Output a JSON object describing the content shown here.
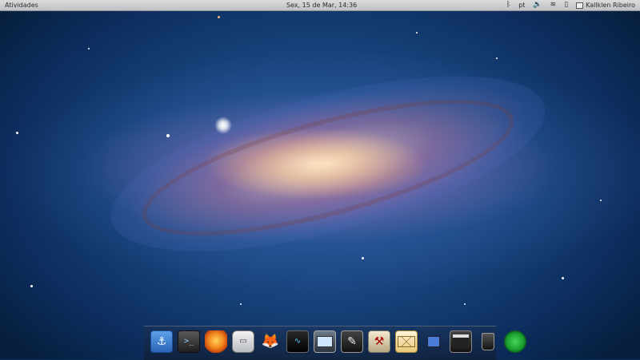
{
  "top_panel": {
    "activities_label": "Atividades",
    "clock": "Sex, 15 de Mar, 14:36",
    "tray": {
      "bluetooth_icon": "bluetooth-icon",
      "keyboard_layout": "pt",
      "volume_icon": "volume-icon",
      "wifi_icon": "wifi-icon",
      "battery_icon": "battery-icon",
      "user_name": "Kallklen Ribeiro"
    }
  },
  "dock": {
    "items": [
      {
        "name": "anchor-app-icon"
      },
      {
        "name": "terminal-icon"
      },
      {
        "name": "firefox-icon"
      },
      {
        "name": "file-manager-icon"
      },
      {
        "name": "gimp-icon"
      },
      {
        "name": "system-monitor-icon"
      },
      {
        "name": "screenshot-icon"
      },
      {
        "name": "inkscape-icon"
      },
      {
        "name": "tools-icon"
      },
      {
        "name": "mail-icon"
      },
      {
        "name": "network-icon"
      },
      {
        "name": "video-editor-icon"
      },
      {
        "name": "trash-icon"
      },
      {
        "name": "power-icon"
      }
    ]
  }
}
